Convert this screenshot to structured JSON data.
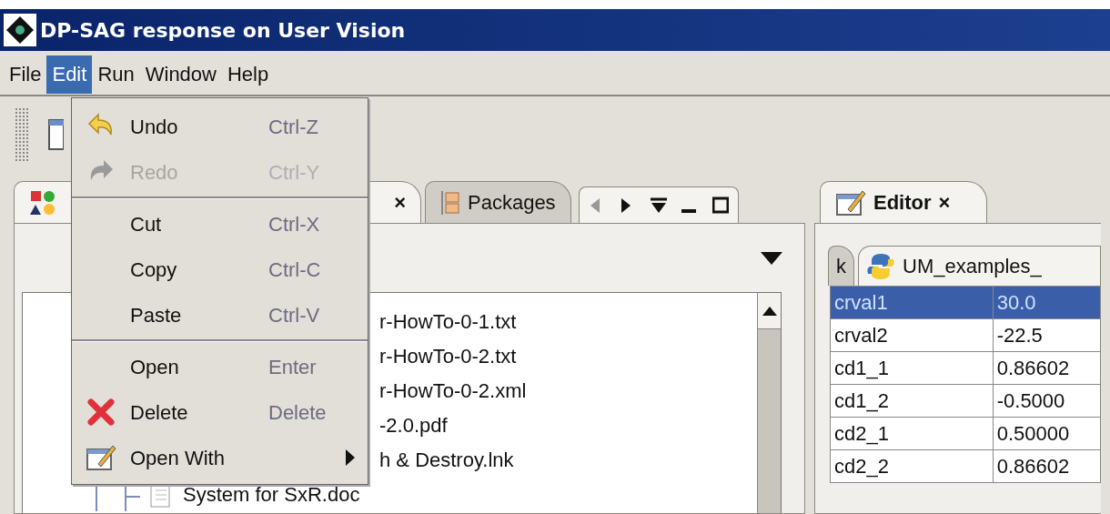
{
  "window": {
    "title": "DP-SAG response on User Vision"
  },
  "menubar": [
    {
      "label": "File",
      "selected": false
    },
    {
      "label": "Edit",
      "selected": true
    },
    {
      "label": "Run",
      "selected": false
    },
    {
      "label": "Window",
      "selected": false
    },
    {
      "label": "Help",
      "selected": false
    }
  ],
  "edit_menu": [
    {
      "kind": "item",
      "label": "Undo",
      "shortcut": "Ctrl-Z",
      "disabled": false,
      "submenu": false
    },
    {
      "kind": "item",
      "label": "Redo",
      "shortcut": "Ctrl-Y",
      "disabled": true,
      "submenu": false
    },
    {
      "kind": "separator"
    },
    {
      "kind": "item",
      "label": "Cut",
      "shortcut": "Ctrl-X",
      "disabled": false,
      "submenu": false
    },
    {
      "kind": "item",
      "label": "Copy",
      "shortcut": "Ctrl-C",
      "disabled": false,
      "submenu": false
    },
    {
      "kind": "item",
      "label": "Paste",
      "shortcut": "Ctrl-V",
      "disabled": false,
      "submenu": false
    },
    {
      "kind": "separator"
    },
    {
      "kind": "item",
      "label": "Open",
      "shortcut": "Enter",
      "disabled": false,
      "submenu": false
    },
    {
      "kind": "item",
      "label": "Delete",
      "shortcut": "Delete",
      "disabled": false,
      "submenu": false
    },
    {
      "kind": "item",
      "label": "Open With",
      "disabled": false,
      "submenu": true
    }
  ],
  "left_panel": {
    "tabs": [
      {
        "close": "×",
        "selected": true
      },
      {
        "label": "Packages",
        "selected": false
      }
    ],
    "tree": [
      {
        "kind": "clipped",
        "label": "r-HowTo-0-1.txt"
      },
      {
        "kind": "clipped",
        "label": "r-HowTo-0-2.txt"
      },
      {
        "kind": "clipped",
        "label": "r-HowTo-0-2.xml"
      },
      {
        "kind": "clipped",
        "label": "-2.0.pdf"
      },
      {
        "kind": "clipped",
        "label": "h & Destroy.lnk"
      },
      {
        "kind": "file",
        "label": "System for SxR.doc"
      }
    ]
  },
  "right_panel": {
    "tab": {
      "label": "Editor",
      "close": "×",
      "selected": true
    },
    "subtabs": [
      {
        "label": "k",
        "selected": false
      },
      {
        "label": "UM_examples_",
        "selected": true
      }
    ],
    "properties": [
      {
        "name": "crval1",
        "value": "30.0",
        "selected": true
      },
      {
        "name": "crval2",
        "value": "-22.5",
        "selected": false
      },
      {
        "name": "cd1_1",
        "value": "0.86602",
        "selected": false
      },
      {
        "name": "cd1_2",
        "value": "-0.5000",
        "selected": false
      },
      {
        "name": "cd2_1",
        "value": "0.50000",
        "selected": false
      },
      {
        "name": "cd2_2",
        "value": "0.86602",
        "selected": false
      }
    ]
  }
}
